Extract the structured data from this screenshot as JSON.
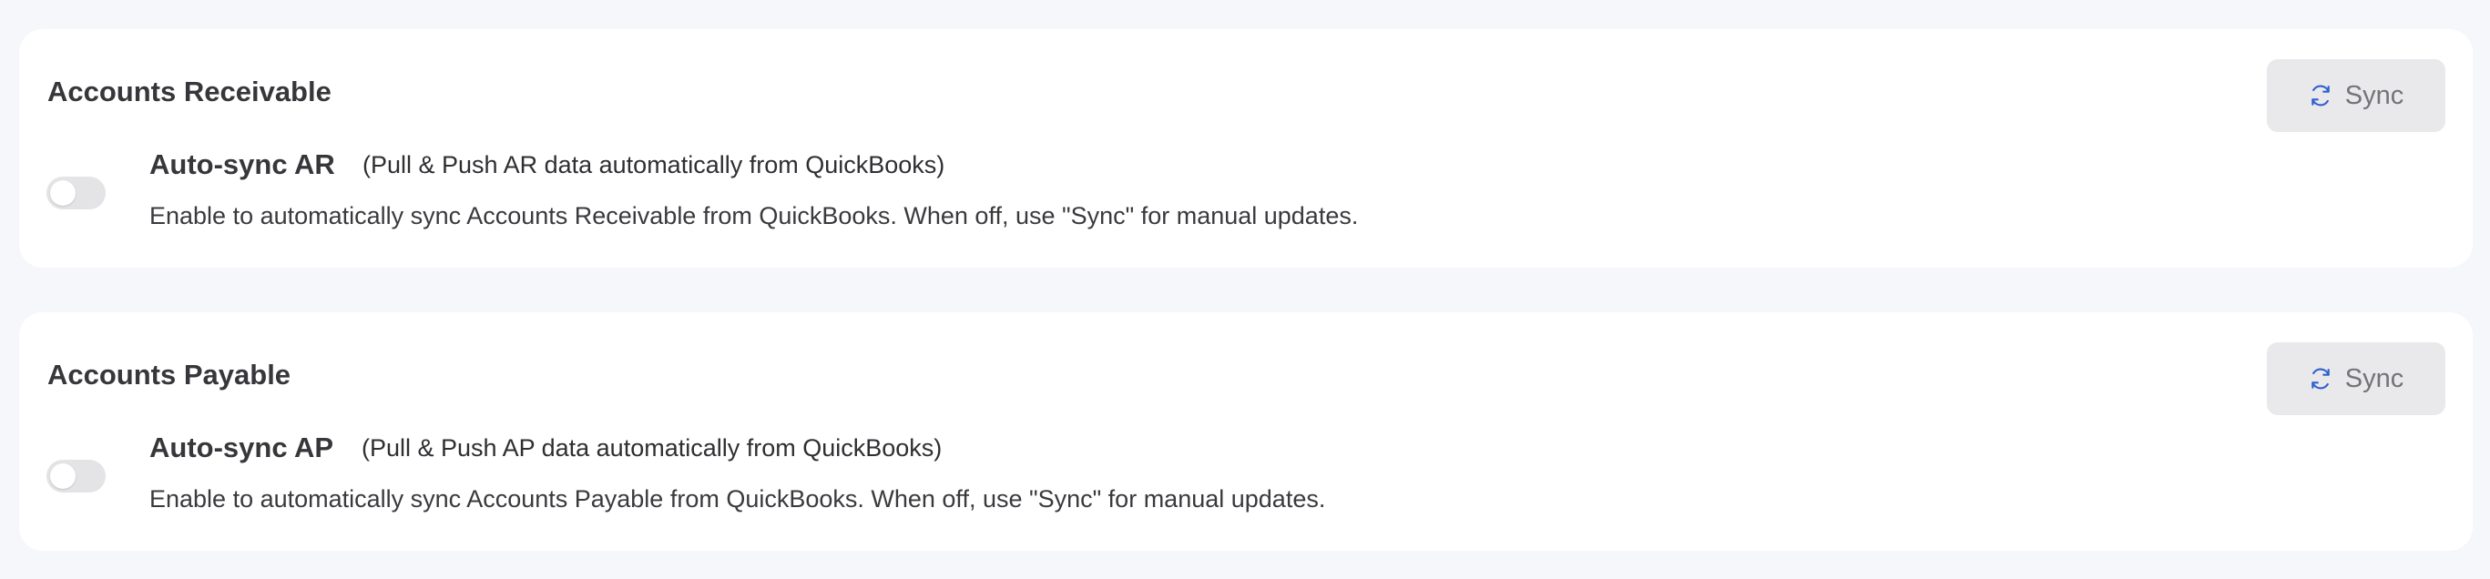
{
  "sections": [
    {
      "title": "Accounts Receivable",
      "sync_button": {
        "label": "Sync",
        "icon": "refresh-icon"
      },
      "setting": {
        "name": "Auto-sync AR",
        "hint": "(Pull & Push AR data automatically from QuickBooks)",
        "description": "Enable to automatically sync Accounts Receivable from QuickBooks. When off, use \"Sync\" for manual updates.",
        "enabled": false
      }
    },
    {
      "title": "Accounts Payable",
      "sync_button": {
        "label": "Sync",
        "icon": "refresh-icon"
      },
      "setting": {
        "name": "Auto-sync AP",
        "hint": "(Pull & Push AP data automatically from QuickBooks)",
        "description": "Enable to automatically sync Accounts Payable from QuickBooks. When off, use \"Sync\" for manual updates.",
        "enabled": false
      }
    }
  ],
  "colors": {
    "page_background": "#f6f7fb",
    "card_background": "#ffffff",
    "sync_icon": "#2f5fd0",
    "sync_button_background": "#e9e9eb",
    "toggle_off": "#e4e4e7"
  }
}
